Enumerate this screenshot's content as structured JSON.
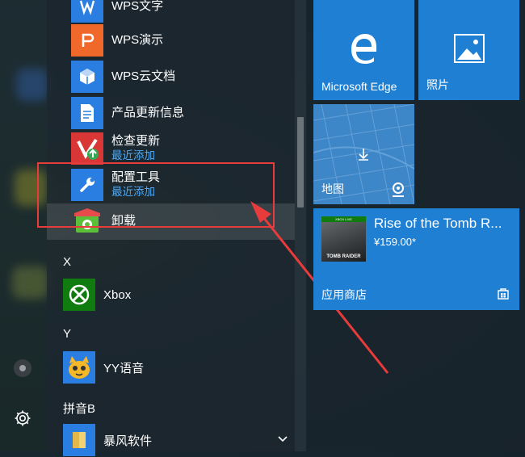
{
  "app_list": {
    "items": [
      {
        "name": "WPS文字"
      },
      {
        "name": "WPS演示"
      },
      {
        "name": "WPS云文档"
      },
      {
        "name": "产品更新信息"
      },
      {
        "name": "检查更新",
        "sub": "最近添加"
      },
      {
        "name": "配置工具",
        "sub": "最近添加"
      },
      {
        "name": "卸载"
      }
    ],
    "section_x": "X",
    "xbox": "Xbox",
    "section_y": "Y",
    "yy": "YY语音",
    "section_pinyin_b": "拼音B",
    "baofeng": "暴风软件"
  },
  "tiles": {
    "edge": "Microsoft Edge",
    "photos": "照片",
    "maps": "地图",
    "store_game_title": "Rise of the Tomb R...",
    "store_price": "¥159.00*",
    "store_label": "应用商店",
    "game_cover_top": "XBOX LIVE",
    "game_cover_title": "TOMB RAIDER"
  },
  "colors": {
    "tile_blue": "#1e7fd3",
    "annotation_red": "#e83b3b",
    "recent_added_blue": "#4ea8f2"
  }
}
